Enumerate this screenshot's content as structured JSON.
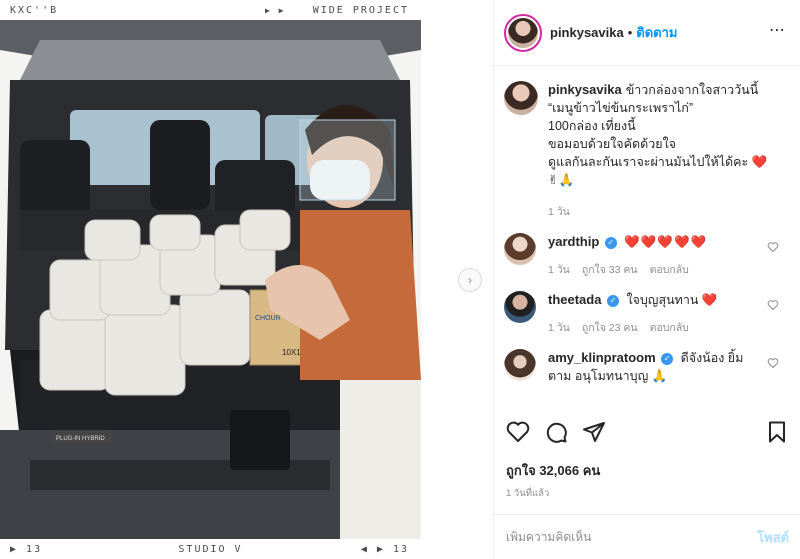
{
  "photo": {
    "top_left_label": "KXC''B",
    "top_right_label": "WIDE PROJECT",
    "bottom_left_label": "13",
    "bottom_center_label": "STUDIO V",
    "bottom_right_label": "13",
    "box_label": "10X1",
    "box_brand": "CHOUR",
    "badge_text": "PLUG-IN HYBRID"
  },
  "post": {
    "username": "pinkysavika",
    "separator": "•",
    "follow_label": "ติดตาม",
    "more_icon": "⋯"
  },
  "caption": {
    "username": "pinkysavika",
    "lines": [
      "ข้าวกล่องจากใจสาววันนี้",
      "“เมนูข้าวไข่ข้นกระเพราไก่”",
      "100กล่อง เที่ยงนี้",
      "ขอมอบด้วยใจคัดด้วยใจ",
      "ดูแลกันละกันเราจะผ่านมันไปให้ได้คะ"
    ],
    "emoji_end": "❤️",
    "emoji_line2": "✌🙏",
    "time": "1 วัน"
  },
  "comments": [
    {
      "username": "yardthip",
      "verified": true,
      "text": "❤️❤️❤️❤️❤️",
      "time": "1 วัน",
      "likes": "ถูกใจ 33 คน",
      "reply": "ตอบกลับ"
    },
    {
      "username": "theetada",
      "verified": true,
      "text": "ใจบุญสุนทาน",
      "emoji": "❤️",
      "time": "1 วัน",
      "likes": "ถูกใจ 23 คน",
      "reply": "ตอบกลับ"
    },
    {
      "username": "amy_klinpratoom",
      "verified": true,
      "text": "ดีจังน้อง ยิ้มตาม อนุโมทนาบุญ",
      "emoji": "🙏"
    }
  ],
  "likes_text": "ถูกใจ 32,066 คน",
  "post_time": "1 วันที่แล้ว",
  "comment_box": {
    "placeholder": "เพิ่มความคิดเห็น",
    "post_label": "โพสต์"
  },
  "carousel_next": "›",
  "colors": {
    "accent": "#0095f6",
    "heart": "#ed4956",
    "muted": "#8e8e8e",
    "text": "#262626"
  }
}
